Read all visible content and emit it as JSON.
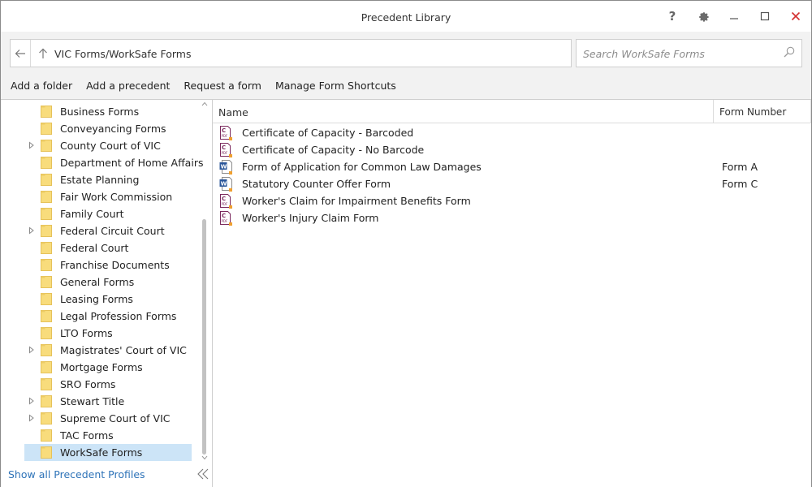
{
  "window": {
    "title": "Precedent Library"
  },
  "titlebar": {
    "help_icon": "help-icon",
    "settings_icon": "gear-icon",
    "minimize_icon": "minimize-icon",
    "maximize_icon": "maximize-icon",
    "close_icon": "close-icon",
    "close_color": "#d32f2f"
  },
  "address": {
    "path": "VIC Forms/WorkSafe Forms"
  },
  "search": {
    "placeholder": "Search WorkSafe Forms",
    "value": ""
  },
  "toolbar": {
    "add_folder": "Add a folder",
    "add_precedent": "Add a precedent",
    "request_form": "Request a form",
    "manage_shortcuts": "Manage Form Shortcuts"
  },
  "tree": {
    "items": [
      {
        "label": "Business Forms",
        "expandable": false,
        "selected": false
      },
      {
        "label": "Conveyancing Forms",
        "expandable": false,
        "selected": false
      },
      {
        "label": "County Court of VIC",
        "expandable": true,
        "selected": false
      },
      {
        "label": "Department of Home Affairs",
        "expandable": false,
        "selected": false
      },
      {
        "label": "Estate Planning",
        "expandable": false,
        "selected": false
      },
      {
        "label": "Fair Work Commission",
        "expandable": false,
        "selected": false
      },
      {
        "label": "Family Court",
        "expandable": false,
        "selected": false
      },
      {
        "label": "Federal Circuit Court",
        "expandable": true,
        "selected": false
      },
      {
        "label": "Federal Court",
        "expandable": false,
        "selected": false
      },
      {
        "label": "Franchise Documents",
        "expandable": false,
        "selected": false
      },
      {
        "label": "General Forms",
        "expandable": false,
        "selected": false
      },
      {
        "label": "Leasing Forms",
        "expandable": false,
        "selected": false
      },
      {
        "label": "Legal Profession Forms",
        "expandable": false,
        "selected": false
      },
      {
        "label": "LTO Forms",
        "expandable": false,
        "selected": false
      },
      {
        "label": "Magistrates' Court of VIC",
        "expandable": true,
        "selected": false
      },
      {
        "label": "Mortgage Forms",
        "expandable": false,
        "selected": false
      },
      {
        "label": "SRO Forms",
        "expandable": false,
        "selected": false
      },
      {
        "label": "Stewart Title",
        "expandable": true,
        "selected": false
      },
      {
        "label": "Supreme Court of VIC",
        "expandable": true,
        "selected": false
      },
      {
        "label": "TAC Forms",
        "expandable": false,
        "selected": false
      },
      {
        "label": "WorkSafe Forms",
        "expandable": false,
        "selected": true
      }
    ],
    "show_all": "Show all Precedent Profiles"
  },
  "table": {
    "columns": {
      "name": "Name",
      "form_number": "Form Number"
    },
    "rows": [
      {
        "name": "Certificate of Capacity - Barcoded",
        "form_number": "",
        "icon": "pdf-form-icon"
      },
      {
        "name": "Certificate of Capacity - No Barcode",
        "form_number": "",
        "icon": "pdf-form-icon"
      },
      {
        "name": "Form of Application for Common Law Damages",
        "form_number": "Form A",
        "icon": "word-form-icon"
      },
      {
        "name": "Statutory Counter Offer Form",
        "form_number": "Form C",
        "icon": "word-form-icon"
      },
      {
        "name": "Worker's Claim for Impairment Benefits Form",
        "form_number": "",
        "icon": "pdf-form-icon"
      },
      {
        "name": "Worker's Injury Claim Form",
        "form_number": "",
        "icon": "pdf-form-icon"
      }
    ]
  },
  "colors": {
    "accent": "#2e73b8",
    "selection": "#cce4f7",
    "folder": "#f5d77a",
    "word": "#2b579a",
    "pdf": "#7b2a5e",
    "badge": "#f0a030"
  }
}
